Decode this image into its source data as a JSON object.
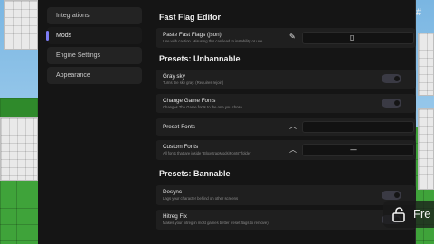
{
  "sidebar": {
    "items": [
      {
        "label": "Integrations",
        "active": false
      },
      {
        "label": "Mods",
        "active": true
      },
      {
        "label": "Engine Settings",
        "active": false
      },
      {
        "label": "Appearance",
        "active": false
      }
    ]
  },
  "header": {
    "title": "Fast Flag Editor"
  },
  "paste_flags": {
    "title": "Paste Fast Flags (json)",
    "description": "Use with caution. Misusing this can lead to instability or une..."
  },
  "sections": {
    "unbannable": "Presets: Unbannable",
    "bannable": "Presets: Bannable"
  },
  "settings": {
    "gray_sky": {
      "title": "Gray sky",
      "description": "Turns the sky gray. (Requires rejoin)",
      "enabled": false
    },
    "change_game_fonts": {
      "title": "Change Game Fonts",
      "description": "Changes The Game fonts to the one you chose",
      "enabled": false
    },
    "preset_fonts": {
      "title": "Preset-Fonts"
    },
    "custom_fonts": {
      "title": "Custom Fonts",
      "description": "All fonts that are inside \"BloxstrapMods\\Fonts\" folder",
      "value": "—"
    },
    "desync": {
      "title": "Desync",
      "description": "Lags your character behind on other screens",
      "enabled": false
    },
    "hitreg_fix": {
      "title": "Hitreg Fix",
      "description": "Makes your hitreg in most games better (reset flags to remove)",
      "enabled": false
    }
  },
  "overlay": {
    "button_label": "Fre",
    "hash_label": "#"
  },
  "icons": {
    "edit": "pencil-icon",
    "paste": "clipboard-icon",
    "chevron": "chevron-up-icon",
    "lock": "lock-icon"
  },
  "colors": {
    "accent": "#7d7df5",
    "panel": "#151515",
    "row": "#1f1f1f"
  }
}
